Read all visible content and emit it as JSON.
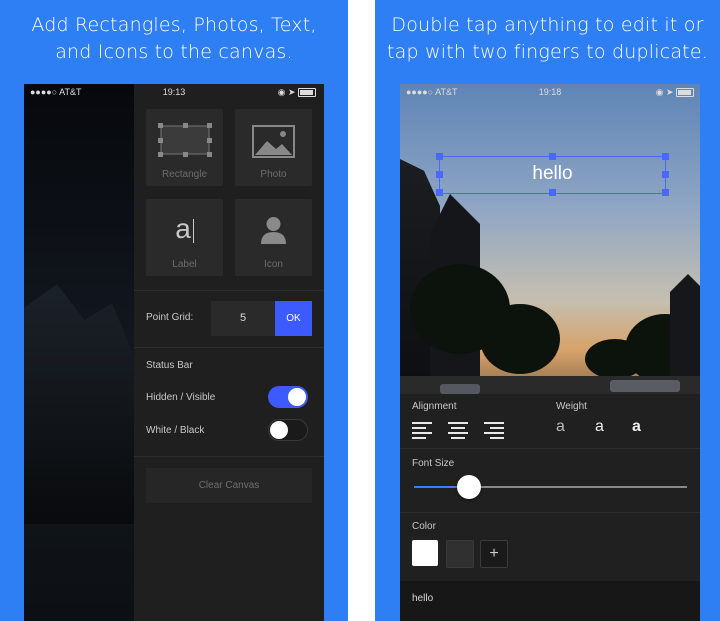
{
  "left_panel": {
    "caption": "Add Rectangles, Photos, Text,\nand Icons to the canvas.",
    "statusbar": {
      "carrier": "●●●●○ AT&T",
      "time": "19:13"
    },
    "tiles": [
      {
        "label": "Rectangle"
      },
      {
        "label": "Photo"
      },
      {
        "label": "Label",
        "glyph": "a"
      },
      {
        "label": "Icon"
      }
    ],
    "point_grid": {
      "label": "Point Grid:",
      "value": "5",
      "ok_label": "OK"
    },
    "status_bar_section": {
      "title": "Status Bar",
      "hidden_visible": {
        "label": "Hidden / Visible",
        "on": true
      },
      "white_black": {
        "label": "White / Black",
        "on": false
      }
    },
    "clear_canvas": "Clear Canvas",
    "accent": "#3d5afe"
  },
  "right_panel": {
    "caption": "Double tap anything to edit it or\ntap with two fingers to duplicate.",
    "statusbar": {
      "carrier": "●●●●○ AT&T",
      "time": "19:18"
    },
    "text_box": "hello",
    "alignment_label": "Alignment",
    "weight_label": "Weight",
    "weights": [
      "a",
      "a",
      "a"
    ],
    "font_size_label": "Font Size",
    "font_size_value": 0.2,
    "color_label": "Color",
    "add_color": "+",
    "text_field_value": "hello"
  }
}
